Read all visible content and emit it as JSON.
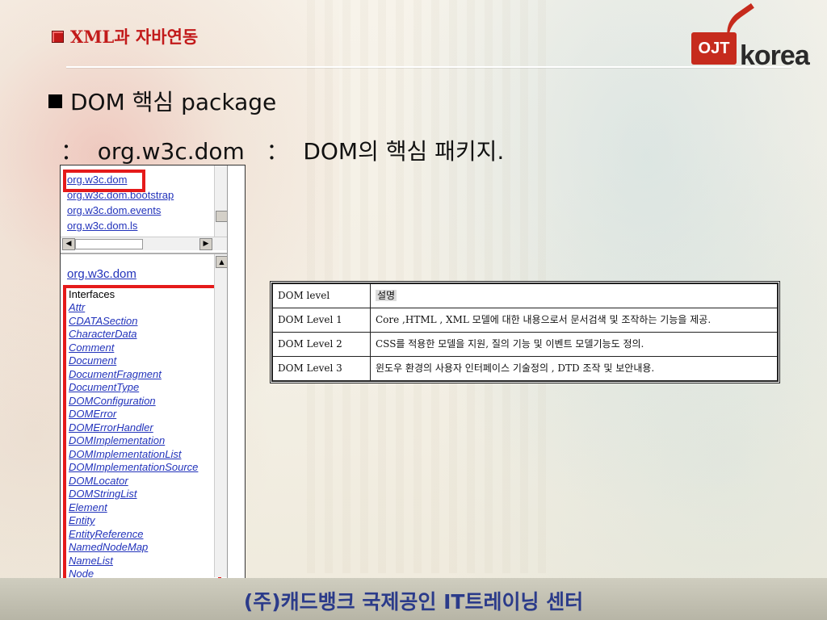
{
  "header": {
    "title": "XML과 자바연동"
  },
  "logo": {
    "box_text": "OJT",
    "word_text": "korea",
    "brand_color": "#c62b1d"
  },
  "slide": {
    "heading": "DOM 핵심 package",
    "subheading": "：  org.w3c.dom   ：  DOM의 핵심 패키지."
  },
  "screenshot": {
    "package_links": [
      "org.w3c.dom",
      "org.w3c.dom.bootstrap",
      "org.w3c.dom.events",
      "org.w3c.dom.ls"
    ],
    "package_title": "org.w3c.dom",
    "interfaces_label": "Interfaces",
    "interfaces": [
      "Attr",
      "CDATASection",
      "CharacterData",
      "Comment",
      "Document",
      "DocumentFragment",
      "DocumentType",
      "DOMConfiguration",
      "DOMError",
      "DOMErrorHandler",
      "DOMImplementation",
      "DOMImplementationList",
      "DOMImplementationSource",
      "DOMLocator",
      "DOMStringList",
      "Element",
      "Entity",
      "EntityReference",
      "NamedNodeMap",
      "NameList",
      "Node"
    ],
    "highlight_color": "#e51a1a"
  },
  "table": {
    "headers": [
      "DOM level",
      "설명"
    ],
    "rows": [
      [
        "DOM Level 1",
        "Core ,HTML , XML 모델에 대한 내용으로서 문서검색 및 조작하는 기능을 제공."
      ],
      [
        "DOM Level 2",
        "CSS를 적용한 모델을 지원, 질의 기능 및 이벤트 모델기능도 정의."
      ],
      [
        "DOM Level 3",
        "윈도우 환경의 사용자 인터페이스 기술정의 , DTD 조작 및 보안내용."
      ]
    ]
  },
  "footer": {
    "text": "(주)캐드뱅크 국제공인 IT트레이닝 센터"
  }
}
